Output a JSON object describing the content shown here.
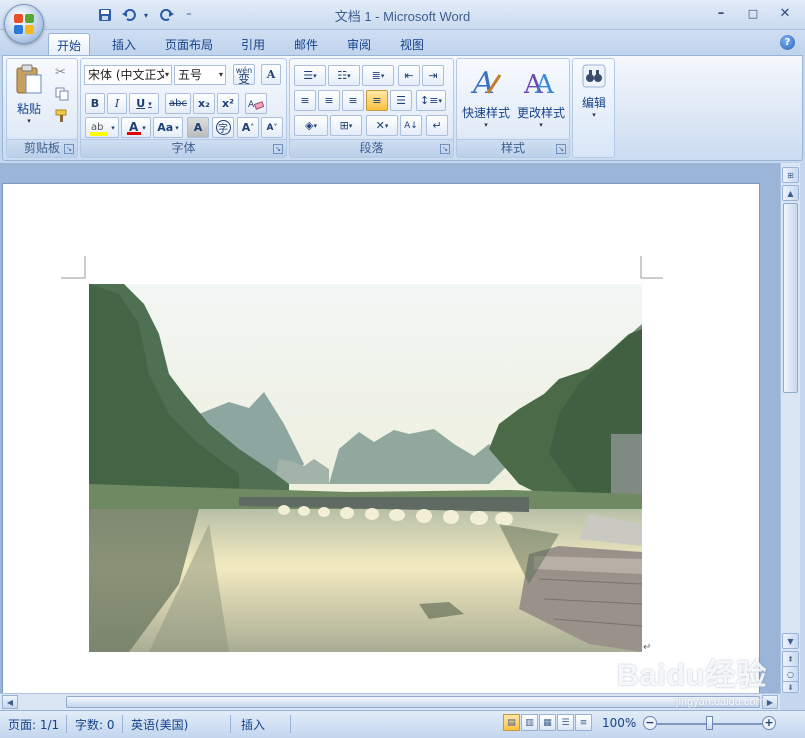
{
  "window": {
    "title": "文档 1 - Microsoft Word",
    "controls": {
      "minimize": "–",
      "maximize": "□",
      "close": "✕"
    }
  },
  "qat": {
    "separator_glyph": "⁼"
  },
  "tabs": [
    "开始",
    "插入",
    "页面布局",
    "引用",
    "邮件",
    "审阅",
    "视图"
  ],
  "active_tab": "开始",
  "help": "?",
  "ribbon": {
    "clipboard": {
      "label": "剪贴板",
      "paste": "粘贴"
    },
    "font": {
      "label": "字体",
      "font_name": "宋体 (中文正文",
      "font_size": "五号",
      "bold": "B",
      "italic": "I",
      "underline": "U",
      "strike": "abc",
      "subscript": "x₂",
      "superscript": "x²",
      "change_case": "Aa",
      "grow": "A",
      "shrink": "A",
      "wen": "wén",
      "char_border": "A",
      "enclose": "字"
    },
    "paragraph": {
      "label": "段落"
    },
    "styles": {
      "label": "样式",
      "quick": "快速样式",
      "change": "更改样式"
    },
    "editing": {
      "label": "编辑"
    }
  },
  "statusbar": {
    "page": "页面: 1/1",
    "words": "字数: 0",
    "language": "英语(美国)",
    "mode": "插入",
    "zoom": "100%"
  },
  "watermark": {
    "text": "Baidu经验",
    "sub": "jingyan.baidu.com"
  },
  "colors": {
    "accent": "#15428b",
    "ribbon_bg": "#dce7f5",
    "page_bg": "#ffffff",
    "workspace": "#9ab5d8",
    "highlight_yellow": "#ffff00",
    "font_red": "#e00000"
  }
}
